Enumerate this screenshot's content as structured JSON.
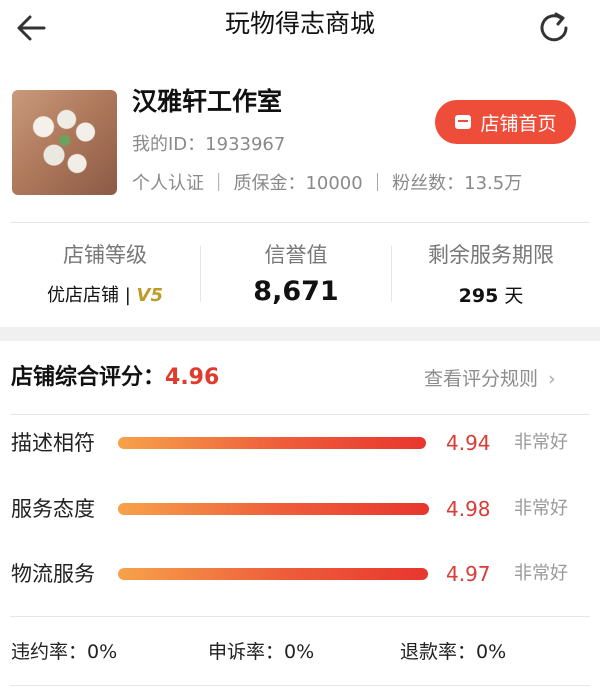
{
  "header": {
    "title": "玩物得志商城"
  },
  "shop": {
    "name": "汉雅轩工作室",
    "id_text": "我的ID：1933967",
    "meta_text": "个人认证 ｜ 质保金：10000 ｜ 粉丝数：13.5万",
    "home_button": "店铺首页"
  },
  "stats": {
    "level": {
      "label": "店铺等级",
      "value": "优店店铺 |",
      "badge": "V5"
    },
    "credit": {
      "label": "信誉值",
      "value": "8,671"
    },
    "remaining": {
      "label": "剩余服务期限",
      "value": "295",
      "unit": "天"
    }
  },
  "rating": {
    "title": "店铺综合评分：",
    "score": "4.96",
    "rules_link": "查看评分规则",
    "rows": [
      {
        "label": "描述相符",
        "score": "4.94",
        "tag": "非常好",
        "fill": 0.988
      },
      {
        "label": "服务态度",
        "score": "4.98",
        "tag": "非常好",
        "fill": 0.996
      },
      {
        "label": "物流服务",
        "score": "4.97",
        "tag": "非常好",
        "fill": 0.994
      }
    ]
  },
  "bottom": {
    "breach": "违约率：0%",
    "complaint": "申诉率：0%",
    "refund": "退款率：0%"
  },
  "colors": {
    "accent": "#ee4d3a",
    "score_red": "#d93c34",
    "vip_gold": "#c09b2a"
  }
}
